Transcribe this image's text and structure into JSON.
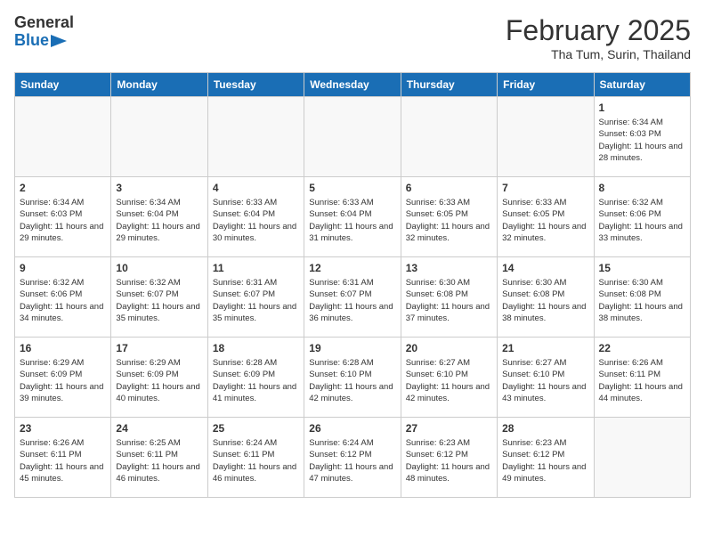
{
  "header": {
    "logo_general": "General",
    "logo_blue": "Blue",
    "title": "February 2025",
    "subtitle": "Tha Tum, Surin, Thailand"
  },
  "weekdays": [
    "Sunday",
    "Monday",
    "Tuesday",
    "Wednesday",
    "Thursday",
    "Friday",
    "Saturday"
  ],
  "weeks": [
    [
      {
        "day": "",
        "info": ""
      },
      {
        "day": "",
        "info": ""
      },
      {
        "day": "",
        "info": ""
      },
      {
        "day": "",
        "info": ""
      },
      {
        "day": "",
        "info": ""
      },
      {
        "day": "",
        "info": ""
      },
      {
        "day": "1",
        "info": "Sunrise: 6:34 AM\nSunset: 6:03 PM\nDaylight: 11 hours and 28 minutes."
      }
    ],
    [
      {
        "day": "2",
        "info": "Sunrise: 6:34 AM\nSunset: 6:03 PM\nDaylight: 11 hours and 29 minutes."
      },
      {
        "day": "3",
        "info": "Sunrise: 6:34 AM\nSunset: 6:04 PM\nDaylight: 11 hours and 29 minutes."
      },
      {
        "day": "4",
        "info": "Sunrise: 6:33 AM\nSunset: 6:04 PM\nDaylight: 11 hours and 30 minutes."
      },
      {
        "day": "5",
        "info": "Sunrise: 6:33 AM\nSunset: 6:04 PM\nDaylight: 11 hours and 31 minutes."
      },
      {
        "day": "6",
        "info": "Sunrise: 6:33 AM\nSunset: 6:05 PM\nDaylight: 11 hours and 32 minutes."
      },
      {
        "day": "7",
        "info": "Sunrise: 6:33 AM\nSunset: 6:05 PM\nDaylight: 11 hours and 32 minutes."
      },
      {
        "day": "8",
        "info": "Sunrise: 6:32 AM\nSunset: 6:06 PM\nDaylight: 11 hours and 33 minutes."
      }
    ],
    [
      {
        "day": "9",
        "info": "Sunrise: 6:32 AM\nSunset: 6:06 PM\nDaylight: 11 hours and 34 minutes."
      },
      {
        "day": "10",
        "info": "Sunrise: 6:32 AM\nSunset: 6:07 PM\nDaylight: 11 hours and 35 minutes."
      },
      {
        "day": "11",
        "info": "Sunrise: 6:31 AM\nSunset: 6:07 PM\nDaylight: 11 hours and 35 minutes."
      },
      {
        "day": "12",
        "info": "Sunrise: 6:31 AM\nSunset: 6:07 PM\nDaylight: 11 hours and 36 minutes."
      },
      {
        "day": "13",
        "info": "Sunrise: 6:30 AM\nSunset: 6:08 PM\nDaylight: 11 hours and 37 minutes."
      },
      {
        "day": "14",
        "info": "Sunrise: 6:30 AM\nSunset: 6:08 PM\nDaylight: 11 hours and 38 minutes."
      },
      {
        "day": "15",
        "info": "Sunrise: 6:30 AM\nSunset: 6:08 PM\nDaylight: 11 hours and 38 minutes."
      }
    ],
    [
      {
        "day": "16",
        "info": "Sunrise: 6:29 AM\nSunset: 6:09 PM\nDaylight: 11 hours and 39 minutes."
      },
      {
        "day": "17",
        "info": "Sunrise: 6:29 AM\nSunset: 6:09 PM\nDaylight: 11 hours and 40 minutes."
      },
      {
        "day": "18",
        "info": "Sunrise: 6:28 AM\nSunset: 6:09 PM\nDaylight: 11 hours and 41 minutes."
      },
      {
        "day": "19",
        "info": "Sunrise: 6:28 AM\nSunset: 6:10 PM\nDaylight: 11 hours and 42 minutes."
      },
      {
        "day": "20",
        "info": "Sunrise: 6:27 AM\nSunset: 6:10 PM\nDaylight: 11 hours and 42 minutes."
      },
      {
        "day": "21",
        "info": "Sunrise: 6:27 AM\nSunset: 6:10 PM\nDaylight: 11 hours and 43 minutes."
      },
      {
        "day": "22",
        "info": "Sunrise: 6:26 AM\nSunset: 6:11 PM\nDaylight: 11 hours and 44 minutes."
      }
    ],
    [
      {
        "day": "23",
        "info": "Sunrise: 6:26 AM\nSunset: 6:11 PM\nDaylight: 11 hours and 45 minutes."
      },
      {
        "day": "24",
        "info": "Sunrise: 6:25 AM\nSunset: 6:11 PM\nDaylight: 11 hours and 46 minutes."
      },
      {
        "day": "25",
        "info": "Sunrise: 6:24 AM\nSunset: 6:11 PM\nDaylight: 11 hours and 46 minutes."
      },
      {
        "day": "26",
        "info": "Sunrise: 6:24 AM\nSunset: 6:12 PM\nDaylight: 11 hours and 47 minutes."
      },
      {
        "day": "27",
        "info": "Sunrise: 6:23 AM\nSunset: 6:12 PM\nDaylight: 11 hours and 48 minutes."
      },
      {
        "day": "28",
        "info": "Sunrise: 6:23 AM\nSunset: 6:12 PM\nDaylight: 11 hours and 49 minutes."
      },
      {
        "day": "",
        "info": ""
      }
    ]
  ]
}
